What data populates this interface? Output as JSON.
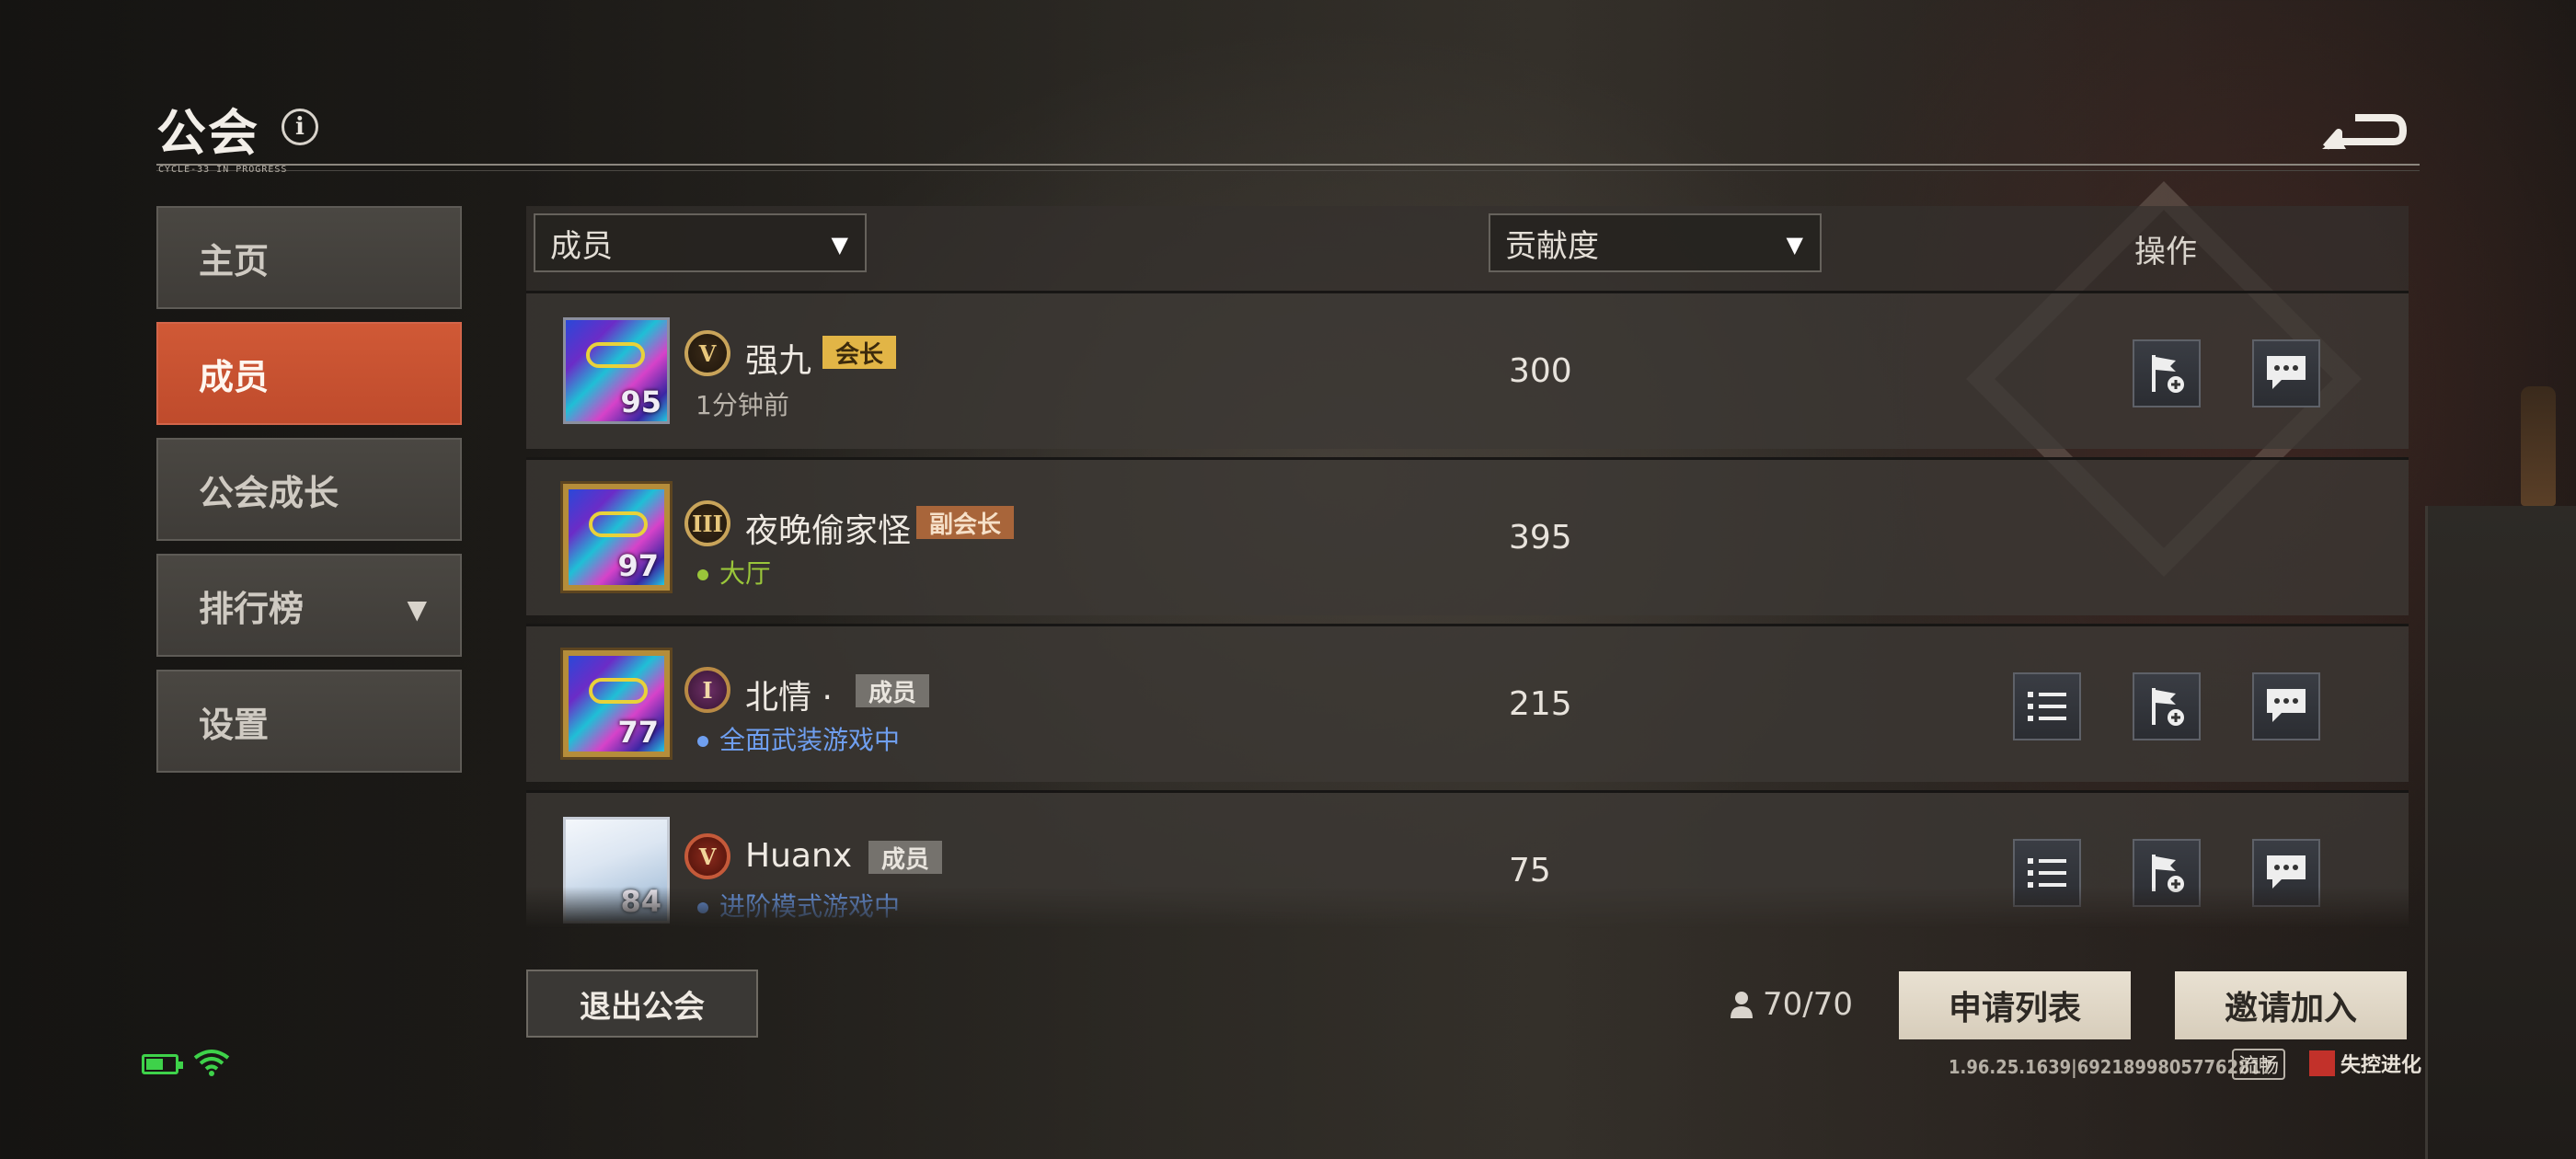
{
  "header": {
    "title": "公会",
    "tagline": "CYCLE-33 IN PROGRESS"
  },
  "sidebar": {
    "items": [
      {
        "label": "主页",
        "active": false
      },
      {
        "label": "成员",
        "active": true
      },
      {
        "label": "公会成长",
        "active": false
      },
      {
        "label": "排行榜",
        "active": false,
        "has_dropdown": true
      },
      {
        "label": "设置",
        "active": false
      }
    ]
  },
  "table": {
    "filter_member": "成员",
    "filter_contribution": "贡献度",
    "ops_header": "操作",
    "rows": [
      {
        "level": "95",
        "rank": "V",
        "name": "强九",
        "role": "会长",
        "status": "1分钟前",
        "status_color": "#b9b3aa",
        "contribution": "300"
      },
      {
        "level": "97",
        "rank": "III",
        "name": "夜晚偷家怪",
        "role": "副会长",
        "status": "大厅",
        "status_color": "#9ac63a",
        "contribution": "395"
      },
      {
        "level": "77",
        "rank": "I",
        "name": "北情 ·",
        "role": "成员",
        "status": "全面武装游戏中",
        "status_color": "#6f9ff0",
        "contribution": "215"
      },
      {
        "level": "84",
        "rank": "V",
        "name": "Huanx",
        "role": "成员",
        "status": "进阶模式游戏中",
        "status_color": "#6f9ff0",
        "contribution": "75"
      }
    ]
  },
  "footer": {
    "quit_label": "退出公会",
    "member_count": "70/70",
    "apply_list_label": "申请列表",
    "invite_label": "邀请加入",
    "version": "1.96.25.1639|69218998057762817",
    "smooth_label": "流畅",
    "logo_text": "失控进化"
  },
  "colors": {
    "accent_active": "#c9512f",
    "leader_badge": "#e2b546",
    "vice_badge": "#a8653a",
    "member_badge": "#75726d",
    "battery_wifi": "#3ed24a"
  }
}
